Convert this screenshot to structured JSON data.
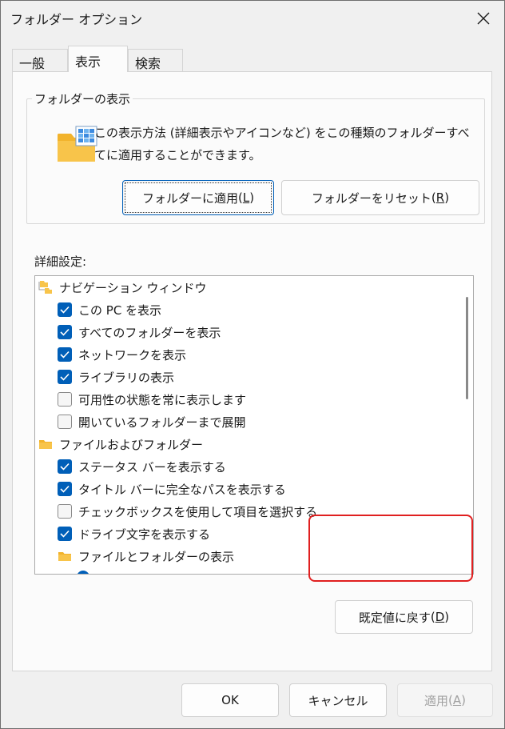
{
  "window": {
    "title": "フォルダー オプション"
  },
  "tabs": [
    {
      "label": "一般",
      "active": false
    },
    {
      "label": "表示",
      "active": true
    },
    {
      "label": "検索",
      "active": false
    }
  ],
  "folder_views": {
    "title": "フォルダーの表示",
    "description": "この表示方法 (詳細表示やアイコンなど) をこの種類のフォルダーすべてに適用することができます。",
    "apply_button": {
      "label": "フォルダーに適用",
      "accel": "L"
    },
    "reset_button": {
      "label": "フォルダーをリセット",
      "accel": "R"
    }
  },
  "advanced": {
    "label": "詳細設定:",
    "items": [
      {
        "type": "category",
        "label": "ナビゲーション ウィンドウ",
        "icon": "nav-pane-icon"
      },
      {
        "type": "checkbox",
        "label": "この PC を表示",
        "checked": true
      },
      {
        "type": "checkbox",
        "label": "すべてのフォルダーを表示",
        "checked": true
      },
      {
        "type": "checkbox",
        "label": "ネットワークを表示",
        "checked": true
      },
      {
        "type": "checkbox",
        "label": "ライブラリの表示",
        "checked": true
      },
      {
        "type": "checkbox",
        "label": "可用性の状態を常に表示します",
        "checked": false
      },
      {
        "type": "checkbox",
        "label": "開いているフォルダーまで展開",
        "checked": false
      },
      {
        "type": "category",
        "label": "ファイルおよびフォルダー",
        "icon": "folder-icon"
      },
      {
        "type": "checkbox",
        "label": "ステータス バーを表示する",
        "checked": true
      },
      {
        "type": "checkbox",
        "label": "タイトル バーに完全なパスを表示する",
        "checked": true
      },
      {
        "type": "checkbox",
        "label": "チェックボックスを使用して項目を選択する",
        "checked": false
      },
      {
        "type": "checkbox",
        "label": "ドライブ文字を表示する",
        "checked": true
      },
      {
        "type": "subcategory",
        "label": "ファイルとフォルダーの表示",
        "icon": "folder-icon"
      }
    ],
    "restore_button": {
      "label": "既定値に戻す",
      "accel": "D"
    }
  },
  "footer": {
    "ok": "OK",
    "cancel": "キャンセル",
    "apply": {
      "label": "適用",
      "accel": "A"
    }
  },
  "colors": {
    "accent": "#005fb8",
    "highlight": "#e02020",
    "folder": "#f8c44a"
  }
}
